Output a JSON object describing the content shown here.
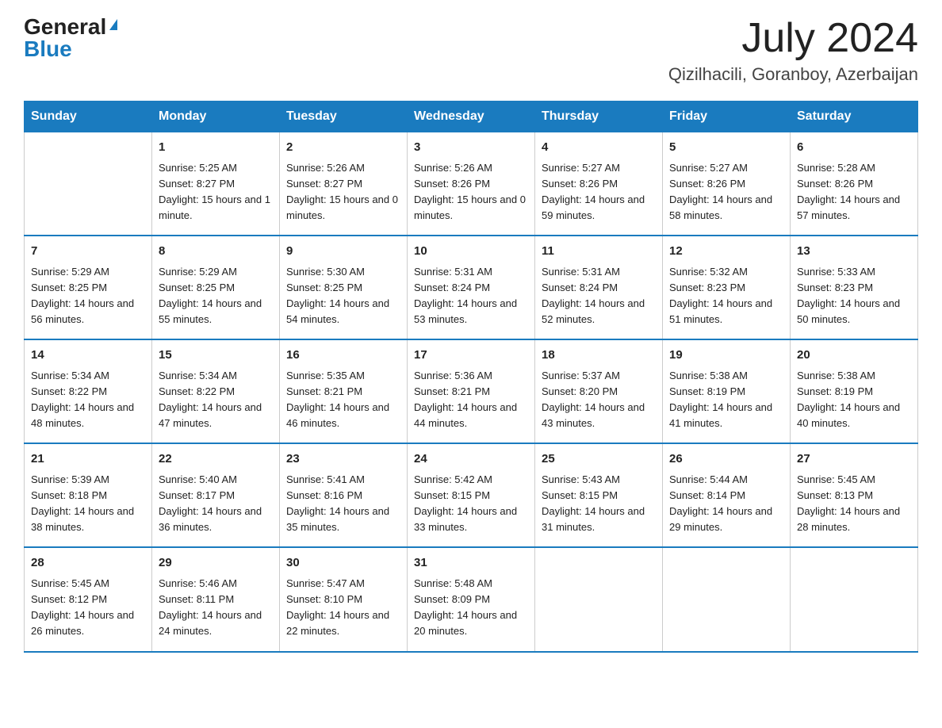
{
  "header": {
    "logo_general": "General",
    "logo_blue": "Blue",
    "title": "July 2024",
    "subtitle": "Qizilhacili, Goranboy, Azerbaijan"
  },
  "days_of_week": [
    "Sunday",
    "Monday",
    "Tuesday",
    "Wednesday",
    "Thursday",
    "Friday",
    "Saturday"
  ],
  "weeks": [
    [
      {
        "day": "",
        "info": ""
      },
      {
        "day": "1",
        "info": "Sunrise: 5:25 AM\nSunset: 8:27 PM\nDaylight: 15 hours\nand 1 minute."
      },
      {
        "day": "2",
        "info": "Sunrise: 5:26 AM\nSunset: 8:27 PM\nDaylight: 15 hours\nand 0 minutes."
      },
      {
        "day": "3",
        "info": "Sunrise: 5:26 AM\nSunset: 8:26 PM\nDaylight: 15 hours\nand 0 minutes."
      },
      {
        "day": "4",
        "info": "Sunrise: 5:27 AM\nSunset: 8:26 PM\nDaylight: 14 hours\nand 59 minutes."
      },
      {
        "day": "5",
        "info": "Sunrise: 5:27 AM\nSunset: 8:26 PM\nDaylight: 14 hours\nand 58 minutes."
      },
      {
        "day": "6",
        "info": "Sunrise: 5:28 AM\nSunset: 8:26 PM\nDaylight: 14 hours\nand 57 minutes."
      }
    ],
    [
      {
        "day": "7",
        "info": "Sunrise: 5:29 AM\nSunset: 8:25 PM\nDaylight: 14 hours\nand 56 minutes."
      },
      {
        "day": "8",
        "info": "Sunrise: 5:29 AM\nSunset: 8:25 PM\nDaylight: 14 hours\nand 55 minutes."
      },
      {
        "day": "9",
        "info": "Sunrise: 5:30 AM\nSunset: 8:25 PM\nDaylight: 14 hours\nand 54 minutes."
      },
      {
        "day": "10",
        "info": "Sunrise: 5:31 AM\nSunset: 8:24 PM\nDaylight: 14 hours\nand 53 minutes."
      },
      {
        "day": "11",
        "info": "Sunrise: 5:31 AM\nSunset: 8:24 PM\nDaylight: 14 hours\nand 52 minutes."
      },
      {
        "day": "12",
        "info": "Sunrise: 5:32 AM\nSunset: 8:23 PM\nDaylight: 14 hours\nand 51 minutes."
      },
      {
        "day": "13",
        "info": "Sunrise: 5:33 AM\nSunset: 8:23 PM\nDaylight: 14 hours\nand 50 minutes."
      }
    ],
    [
      {
        "day": "14",
        "info": "Sunrise: 5:34 AM\nSunset: 8:22 PM\nDaylight: 14 hours\nand 48 minutes."
      },
      {
        "day": "15",
        "info": "Sunrise: 5:34 AM\nSunset: 8:22 PM\nDaylight: 14 hours\nand 47 minutes."
      },
      {
        "day": "16",
        "info": "Sunrise: 5:35 AM\nSunset: 8:21 PM\nDaylight: 14 hours\nand 46 minutes."
      },
      {
        "day": "17",
        "info": "Sunrise: 5:36 AM\nSunset: 8:21 PM\nDaylight: 14 hours\nand 44 minutes."
      },
      {
        "day": "18",
        "info": "Sunrise: 5:37 AM\nSunset: 8:20 PM\nDaylight: 14 hours\nand 43 minutes."
      },
      {
        "day": "19",
        "info": "Sunrise: 5:38 AM\nSunset: 8:19 PM\nDaylight: 14 hours\nand 41 minutes."
      },
      {
        "day": "20",
        "info": "Sunrise: 5:38 AM\nSunset: 8:19 PM\nDaylight: 14 hours\nand 40 minutes."
      }
    ],
    [
      {
        "day": "21",
        "info": "Sunrise: 5:39 AM\nSunset: 8:18 PM\nDaylight: 14 hours\nand 38 minutes."
      },
      {
        "day": "22",
        "info": "Sunrise: 5:40 AM\nSunset: 8:17 PM\nDaylight: 14 hours\nand 36 minutes."
      },
      {
        "day": "23",
        "info": "Sunrise: 5:41 AM\nSunset: 8:16 PM\nDaylight: 14 hours\nand 35 minutes."
      },
      {
        "day": "24",
        "info": "Sunrise: 5:42 AM\nSunset: 8:15 PM\nDaylight: 14 hours\nand 33 minutes."
      },
      {
        "day": "25",
        "info": "Sunrise: 5:43 AM\nSunset: 8:15 PM\nDaylight: 14 hours\nand 31 minutes."
      },
      {
        "day": "26",
        "info": "Sunrise: 5:44 AM\nSunset: 8:14 PM\nDaylight: 14 hours\nand 29 minutes."
      },
      {
        "day": "27",
        "info": "Sunrise: 5:45 AM\nSunset: 8:13 PM\nDaylight: 14 hours\nand 28 minutes."
      }
    ],
    [
      {
        "day": "28",
        "info": "Sunrise: 5:45 AM\nSunset: 8:12 PM\nDaylight: 14 hours\nand 26 minutes."
      },
      {
        "day": "29",
        "info": "Sunrise: 5:46 AM\nSunset: 8:11 PM\nDaylight: 14 hours\nand 24 minutes."
      },
      {
        "day": "30",
        "info": "Sunrise: 5:47 AM\nSunset: 8:10 PM\nDaylight: 14 hours\nand 22 minutes."
      },
      {
        "day": "31",
        "info": "Sunrise: 5:48 AM\nSunset: 8:09 PM\nDaylight: 14 hours\nand 20 minutes."
      },
      {
        "day": "",
        "info": ""
      },
      {
        "day": "",
        "info": ""
      },
      {
        "day": "",
        "info": ""
      }
    ]
  ]
}
